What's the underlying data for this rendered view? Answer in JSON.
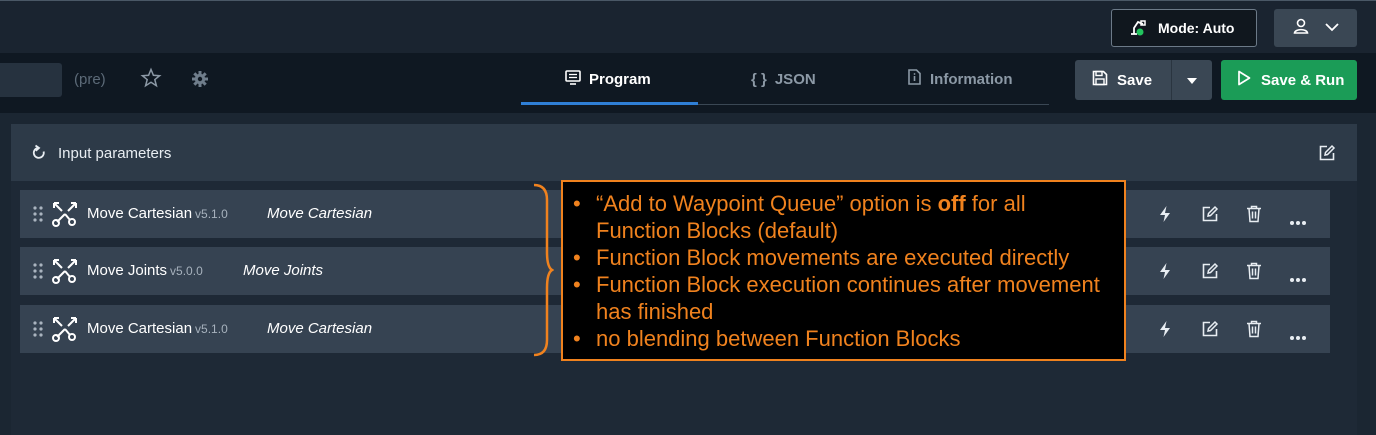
{
  "header": {
    "mode_label": "Mode: Auto"
  },
  "program": {
    "suffix": "(pre)"
  },
  "tabs": [
    {
      "label": "Program",
      "active": true
    },
    {
      "label": "JSON",
      "icon_text": "{ }"
    },
    {
      "label": "Information"
    }
  ],
  "actions": {
    "save_label": "Save",
    "save_run_label": "Save & Run"
  },
  "panel": {
    "title": "Input parameters"
  },
  "blocks": [
    {
      "name": "Move Cartesian",
      "version": "v5.1.0",
      "alias": "Move Cartesian"
    },
    {
      "name": "Move Joints",
      "version": "v5.0.0",
      "alias": "Move Joints"
    },
    {
      "name": "Move Cartesian",
      "version": "v5.1.0",
      "alias": "Move Cartesian"
    }
  ],
  "callout": {
    "line1_pre": "“Add to Waypoint Queue” option is ",
    "line1_bold": "off",
    "line1_post": " for all Function Blocks (default)",
    "line2": "Function Block movements are executed directly",
    "line3": "Function Block execution continues after movement has finished",
    "line4": "no blending between Function Blocks"
  },
  "colors": {
    "accent_blue": "#2f7fd6",
    "run_green": "#1b9c57",
    "callout_orange": "#f0821e",
    "mode_dot_green": "#22c55e"
  }
}
